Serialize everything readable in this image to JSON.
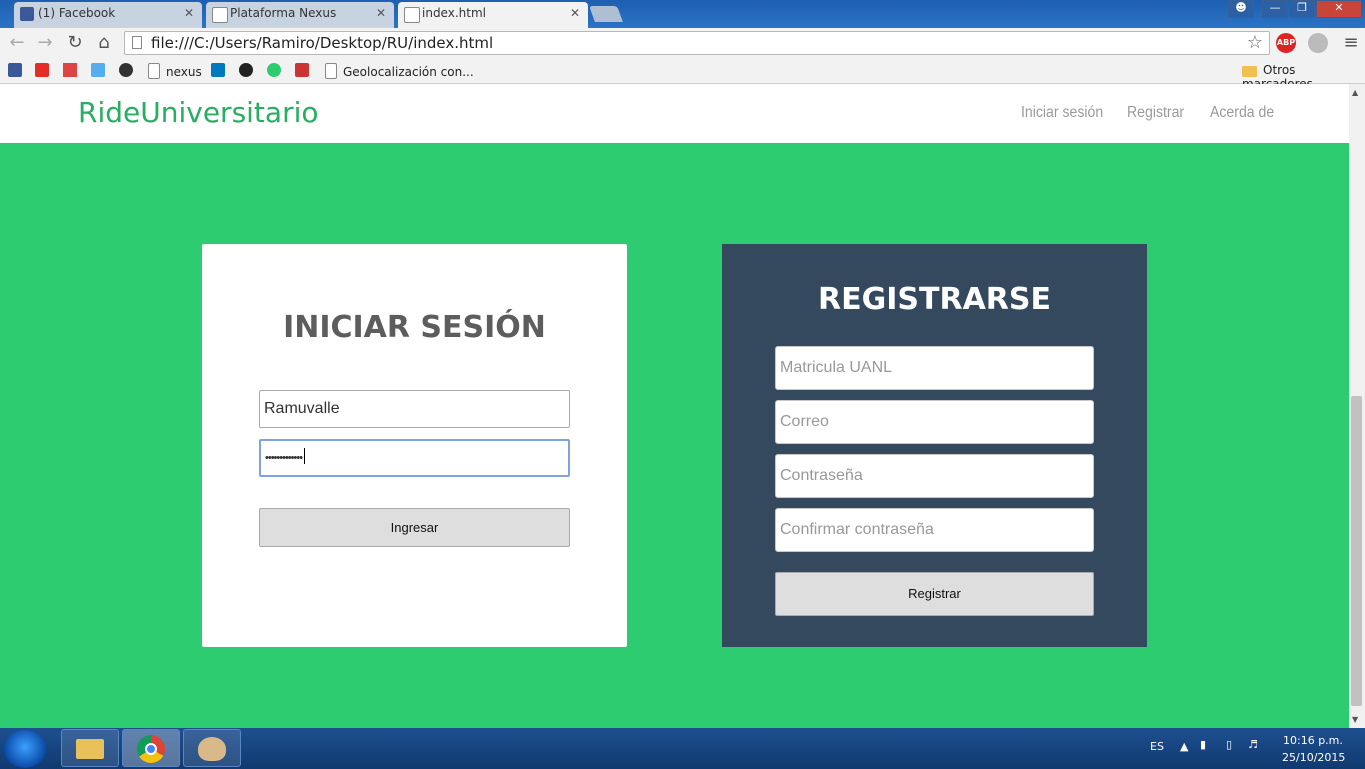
{
  "browser": {
    "tabs": [
      {
        "title": "(1) Facebook",
        "close": "✕"
      },
      {
        "title": "Plataforma Nexus",
        "close": "✕"
      },
      {
        "title": "index.html",
        "close": "✕"
      }
    ],
    "url": "file:///C:/Users/Ramiro/Desktop/RU/index.html",
    "extensions": [
      "ABP"
    ],
    "bookmarks": [
      {
        "label": "nexus"
      },
      {
        "label": "Geolocalización con..."
      }
    ],
    "other_bookmarks": "Otros marcadores"
  },
  "site": {
    "brand": "RideUniversitario",
    "nav": [
      "Iniciar sesión",
      "Registrar",
      "Acerda de"
    ]
  },
  "login": {
    "title": "INICIAR SESIÓN",
    "username_value": "Ramuvalle",
    "password_value": "•••••••••••••",
    "submit_label": "Ingresar"
  },
  "register": {
    "title": "REGISTRARSE",
    "fields": [
      "Matricula UANL",
      "Correo",
      "Contraseña",
      "Confirmar contraseña"
    ],
    "submit_label": "Registrar"
  },
  "taskbar": {
    "lang": "ES",
    "time": "10:16 p.m.",
    "date": "25/10/2015"
  },
  "colors": {
    "page_bg": "#2ecc71",
    "brand": "#27ae60",
    "register_bg": "#34495e"
  }
}
